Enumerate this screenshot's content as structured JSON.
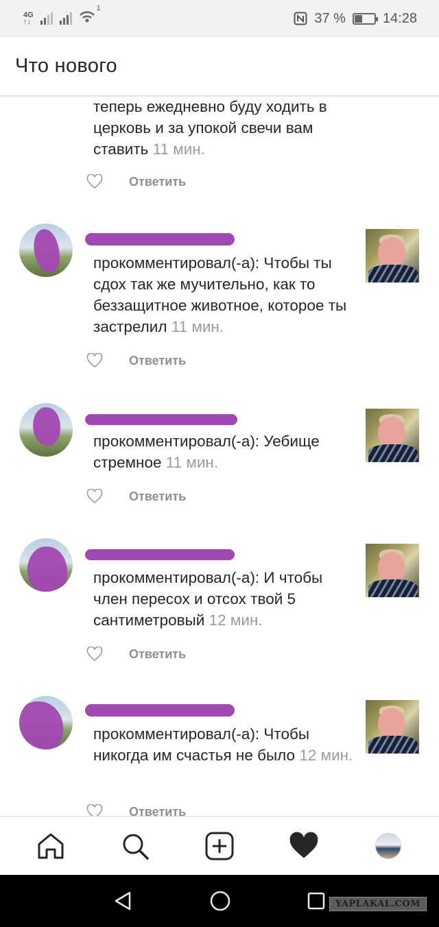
{
  "status_bar": {
    "network_label_top": "4G",
    "network_label_bottom": "↑↓",
    "wifi_badge": "1",
    "battery_percent": "37 %",
    "time": "14:28"
  },
  "header": {
    "title": "Что нового"
  },
  "items": [
    {
      "text": "теперь ежедневно буду ходить в церковь и за упокой свечи вам ставить",
      "time": "11 мин.",
      "reply": "Ответить"
    },
    {
      "text": "прокомментировал(-а): Чтобы ты сдох так же мучительно, как то беззащитное животное, которое ты застрелил",
      "time": "11 мин.",
      "reply": "Ответить"
    },
    {
      "text": "прокомментировал(-а): Уебище стремное",
      "time": "11 мин.",
      "reply": "Ответить"
    },
    {
      "text": "прокомментировал(-а): И чтобы член пересох и отсох твой 5 сантиметровый",
      "time": "12 мин.",
      "reply": "Ответить"
    },
    {
      "text": "прокомментировал(-а): Чтобы никогда им счастья не было",
      "time": "12 мин.",
      "reply": "Ответить"
    }
  ],
  "bottom_nav": {
    "icons": [
      "home-icon",
      "search-icon",
      "add-post-icon",
      "activity-heart-icon",
      "profile-avatar"
    ]
  },
  "system_nav": {
    "icons": [
      "back-icon",
      "home-circle-icon",
      "recents-square-icon"
    ]
  },
  "watermark": "YAPLAKAL.COM",
  "colors": {
    "redaction": "#a248b2",
    "timestamp": "#9a9a9a",
    "reply": "#8e8e8e"
  }
}
